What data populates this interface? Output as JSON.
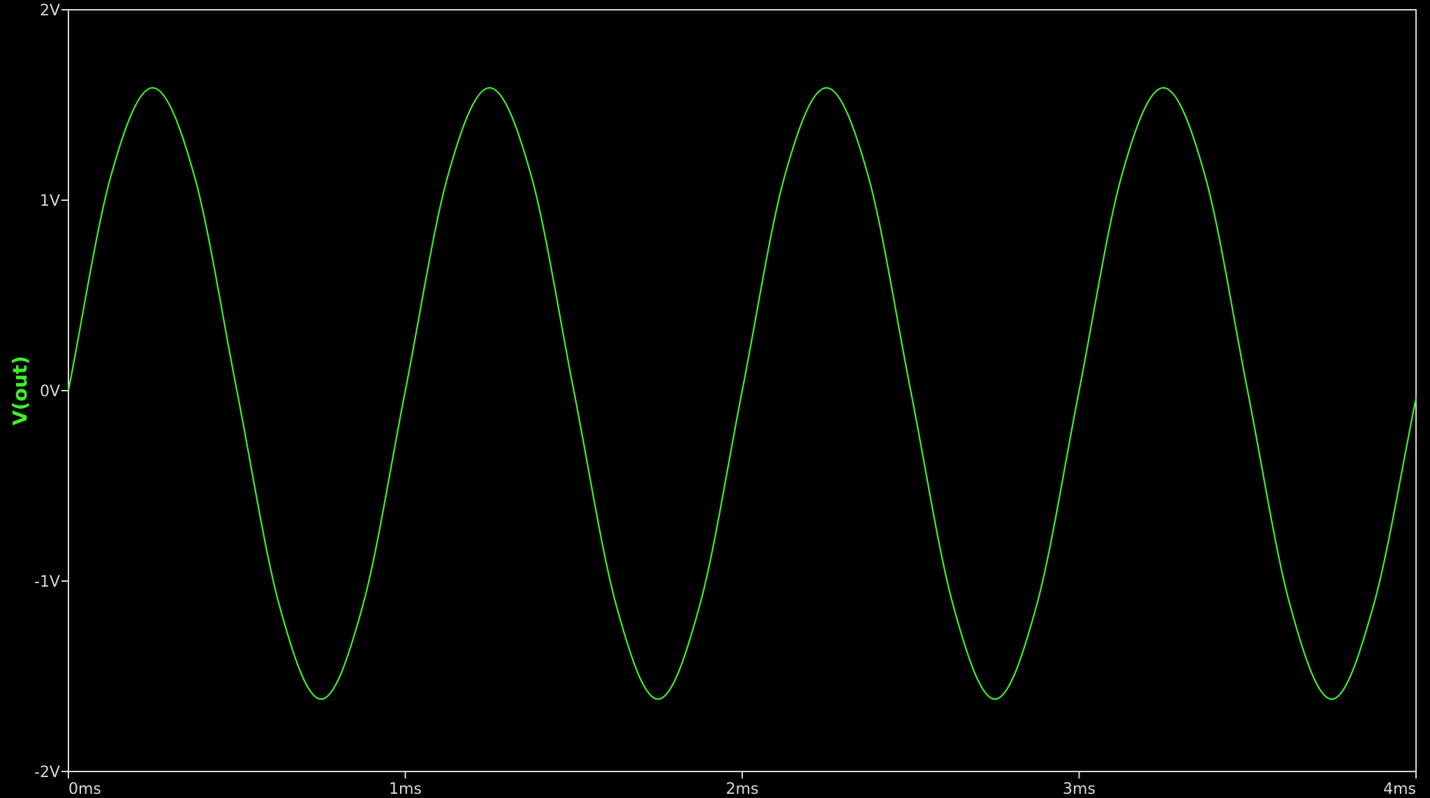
{
  "colors": {
    "background": "#000000",
    "axes": "#d8d8d8",
    "trace": "#3cf02a"
  },
  "chart_data": {
    "type": "line",
    "title": "",
    "xlabel": "",
    "ylabel": "V(out)",
    "xlim": [
      0,
      4
    ],
    "ylim": [
      -2,
      2
    ],
    "x_unit": "ms",
    "y_unit": "V",
    "x_ticks": [
      {
        "value": 0,
        "label": "0ms"
      },
      {
        "value": 1,
        "label": "1ms"
      },
      {
        "value": 2,
        "label": "2ms"
      },
      {
        "value": 3,
        "label": "3ms"
      },
      {
        "value": 4,
        "label": "4ms"
      }
    ],
    "y_ticks": [
      {
        "value": 2,
        "label": "2V"
      },
      {
        "value": 1,
        "label": "1V"
      },
      {
        "value": 0,
        "label": "0V"
      },
      {
        "value": -1,
        "label": "-1V"
      },
      {
        "value": -2,
        "label": "-2V"
      }
    ],
    "grid": false,
    "series": [
      {
        "name": "V(out)",
        "x": [
          0,
          0.125,
          0.25,
          0.375,
          0.5,
          0.625,
          0.75,
          0.875,
          1.0,
          1.125,
          1.25,
          1.375,
          1.5,
          1.625,
          1.75,
          1.875,
          2.0,
          2.125,
          2.25,
          2.375,
          2.5,
          2.625,
          2.75,
          2.875,
          3.0,
          3.125,
          3.25,
          3.375,
          3.5,
          3.625,
          3.75,
          3.875,
          4.0
        ],
        "y": [
          0,
          1.12,
          1.59,
          1.12,
          0,
          -1.12,
          -1.62,
          -1.12,
          0,
          1.12,
          1.59,
          1.12,
          0,
          -1.12,
          -1.62,
          -1.12,
          0,
          1.12,
          1.59,
          1.12,
          0,
          -1.12,
          -1.62,
          -1.12,
          0,
          1.12,
          1.59,
          1.12,
          0,
          -1.12,
          -1.62,
          -1.12,
          -0.04
        ]
      }
    ]
  }
}
